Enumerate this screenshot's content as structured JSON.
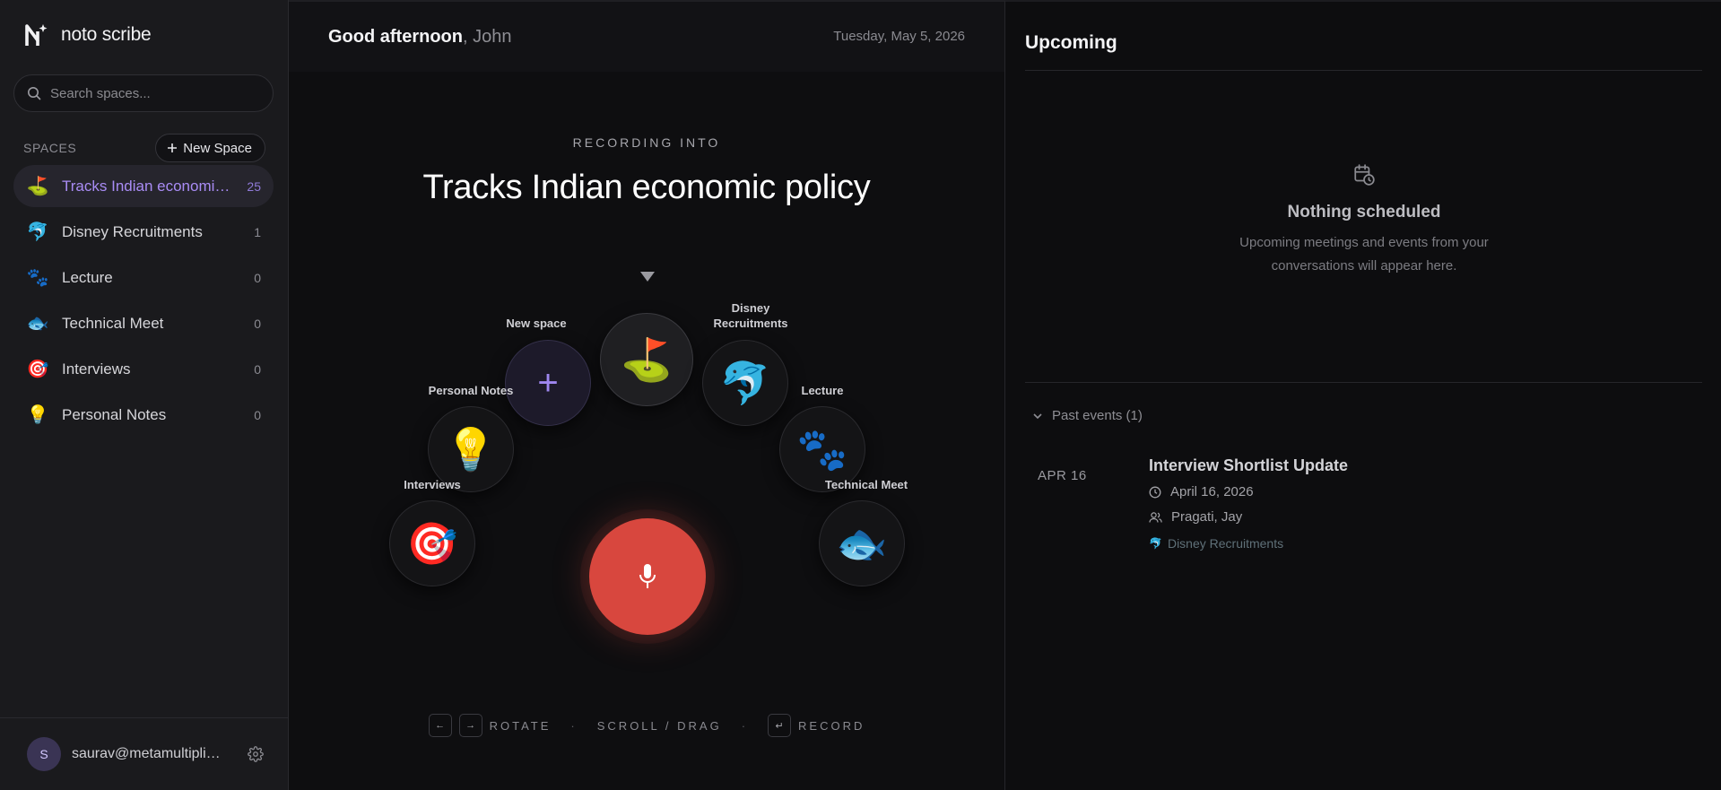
{
  "app": {
    "name": "noto scribe"
  },
  "search": {
    "placeholder": "Search spaces..."
  },
  "spaces": {
    "label": "SPACES",
    "new_space_label": "New Space",
    "items": [
      {
        "emoji": "⛳",
        "name": "Tracks Indian economic policy",
        "count": "25"
      },
      {
        "emoji": "🐬",
        "name": "Disney Recruitments",
        "count": "1"
      },
      {
        "emoji": "🐾",
        "name": "Lecture",
        "count": "0"
      },
      {
        "emoji": "🐟",
        "name": "Technical Meet",
        "count": "0"
      },
      {
        "emoji": "🎯",
        "name": "Interviews",
        "count": "0"
      },
      {
        "emoji": "💡",
        "name": "Personal Notes",
        "count": "0"
      }
    ]
  },
  "user": {
    "initial": "S",
    "email": "saurav@metamultiplier.com"
  },
  "header": {
    "greeting": "Good afternoon",
    "name_suffix": ", John",
    "date": "Tuesday, May 5, 2026"
  },
  "recording": {
    "label": "RECORDING INTO",
    "title": "Tracks Indian economic policy",
    "wheel": {
      "center": {
        "emoji": "⛳"
      },
      "new_space": {
        "label": "New space",
        "symbol": "+"
      },
      "disney": {
        "label_line1": "Disney",
        "label_line2": "Recruitments",
        "emoji": "🐬"
      },
      "personal": {
        "label": "Personal Notes",
        "emoji": "💡"
      },
      "lecture": {
        "label": "Lecture",
        "emoji": "🐾"
      },
      "interviews": {
        "label": "Interviews",
        "emoji": "🎯"
      },
      "technical": {
        "label": "Technical Meet",
        "emoji": "🐟"
      }
    },
    "accent_color": "#d8473e"
  },
  "hints": {
    "key_left": "←",
    "key_right": "→",
    "rotate": "ROTATE",
    "scroll": "SCROLL / DRAG",
    "key_enter": "↵",
    "record": "RECORD",
    "separator": "·"
  },
  "upcoming": {
    "title": "Upcoming",
    "empty_title": "Nothing scheduled",
    "empty_sub_line1": "Upcoming meetings and events from your",
    "empty_sub_line2": "conversations will appear here.",
    "past_label": "Past events (1)",
    "events": [
      {
        "date_badge": "APR 16",
        "title": "Interview Shortlist Update",
        "date": "April 16, 2026",
        "people": "Pragati, Jay",
        "space_emoji": "🐬",
        "space": "Disney Recruitments"
      }
    ]
  }
}
